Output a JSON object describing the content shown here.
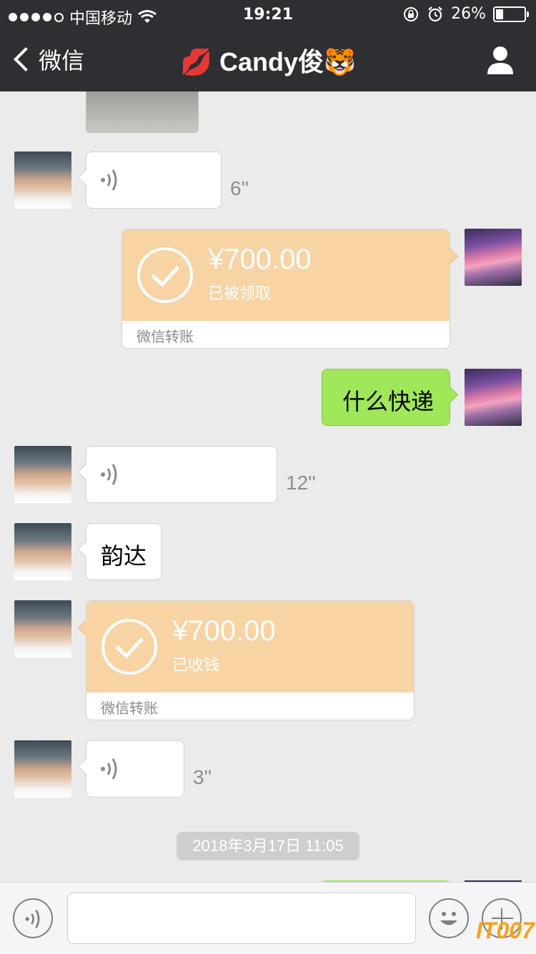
{
  "status_bar": {
    "carrier": "中国移动",
    "time": "19:21",
    "battery": "26%",
    "battery_level": 0.26,
    "signal_bars": 4
  },
  "nav": {
    "back_label": "微信",
    "title": "Candy俊",
    "title_prefix_emoji": "💋",
    "title_suffix_emoji": "🐯"
  },
  "messages": [
    {
      "side": "left",
      "type": "voice",
      "duration": "6''"
    },
    {
      "side": "right",
      "type": "transfer",
      "amount": "¥700.00",
      "status": "已被领取",
      "footer": "微信转账"
    },
    {
      "side": "right",
      "type": "text",
      "text": "什么快递"
    },
    {
      "side": "left",
      "type": "voice",
      "duration": "12''"
    },
    {
      "side": "left",
      "type": "text",
      "text": "韵达"
    },
    {
      "side": "left",
      "type": "transfer",
      "amount": "¥700.00",
      "status": "已收钱",
      "footer": "微信转账"
    },
    {
      "side": "left",
      "type": "voice",
      "duration": "3''"
    }
  ],
  "timestamp": "2018年3月17日 11:05",
  "watermark": "IT007",
  "colors": {
    "header_bg": "#2e2e33",
    "chat_bg": "#ebebeb",
    "green_bubble": "#a0e759",
    "transfer_bg": "#f8d3a4"
  }
}
